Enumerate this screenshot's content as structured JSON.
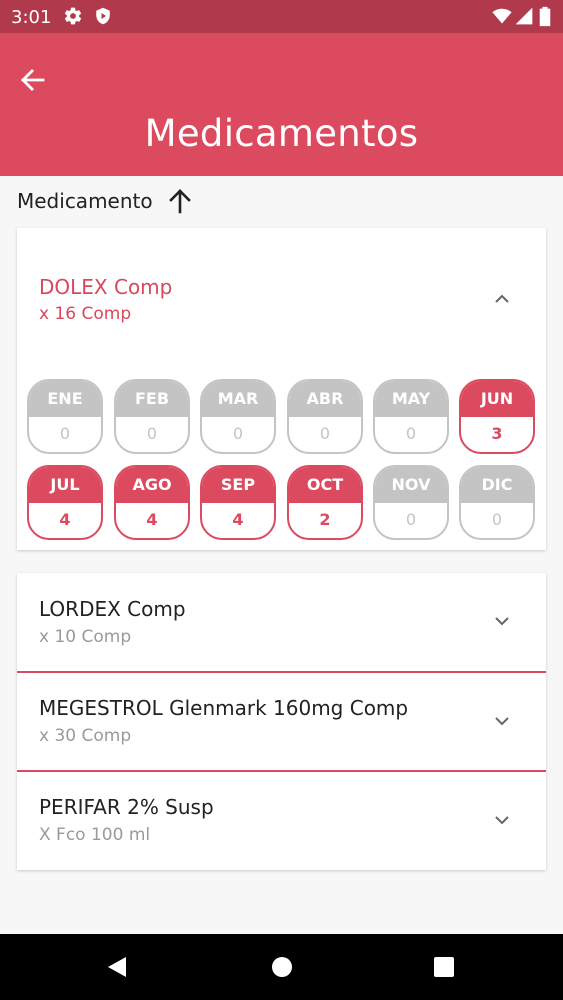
{
  "status_bar": {
    "time": "3:01",
    "icons": [
      "gear-icon",
      "shield-icon",
      "wifi-icon",
      "signal-icon",
      "battery-icon"
    ]
  },
  "app_bar": {
    "title": "Medicamentos",
    "back_icon": "arrow-left-icon",
    "color": "#dc4a5f"
  },
  "sort": {
    "label": "Medicamento",
    "icon": "arrow-up-icon"
  },
  "expanded_item": {
    "name": "DOLEX  Comp",
    "quantity": "x 16  Comp",
    "icon": "chevron-up-icon",
    "months": [
      {
        "label": "ENE",
        "value": "0",
        "active": false
      },
      {
        "label": "FEB",
        "value": "0",
        "active": false
      },
      {
        "label": "MAR",
        "value": "0",
        "active": false
      },
      {
        "label": "ABR",
        "value": "0",
        "active": false
      },
      {
        "label": "MAY",
        "value": "0",
        "active": false
      },
      {
        "label": "JUN",
        "value": "3",
        "active": true
      },
      {
        "label": "JUL",
        "value": "4",
        "active": true
      },
      {
        "label": "AGO",
        "value": "4",
        "active": true
      },
      {
        "label": "SEP",
        "value": "4",
        "active": true
      },
      {
        "label": "OCT",
        "value": "2",
        "active": true
      },
      {
        "label": "NOV",
        "value": "0",
        "active": false
      },
      {
        "label": "DIC",
        "value": "0",
        "active": false
      }
    ]
  },
  "items": [
    {
      "name": "LORDEX Comp",
      "quantity": "x 10 Comp",
      "icon": "chevron-down-icon"
    },
    {
      "name": "MEGESTROL  Glenmark 160mg Comp",
      "quantity": "x 30 Comp",
      "icon": "chevron-down-icon"
    },
    {
      "name": "PERIFAR 2% Susp",
      "quantity": "X Fco 100 ml",
      "icon": "chevron-down-icon"
    }
  ],
  "nav_bar": {
    "icons": [
      "back-triangle-icon",
      "home-circle-icon",
      "recents-square-icon"
    ]
  },
  "colors": {
    "accent": "#dc4a5f",
    "status_bar": "#b03a4b",
    "inactive": "#c4c4c5"
  }
}
